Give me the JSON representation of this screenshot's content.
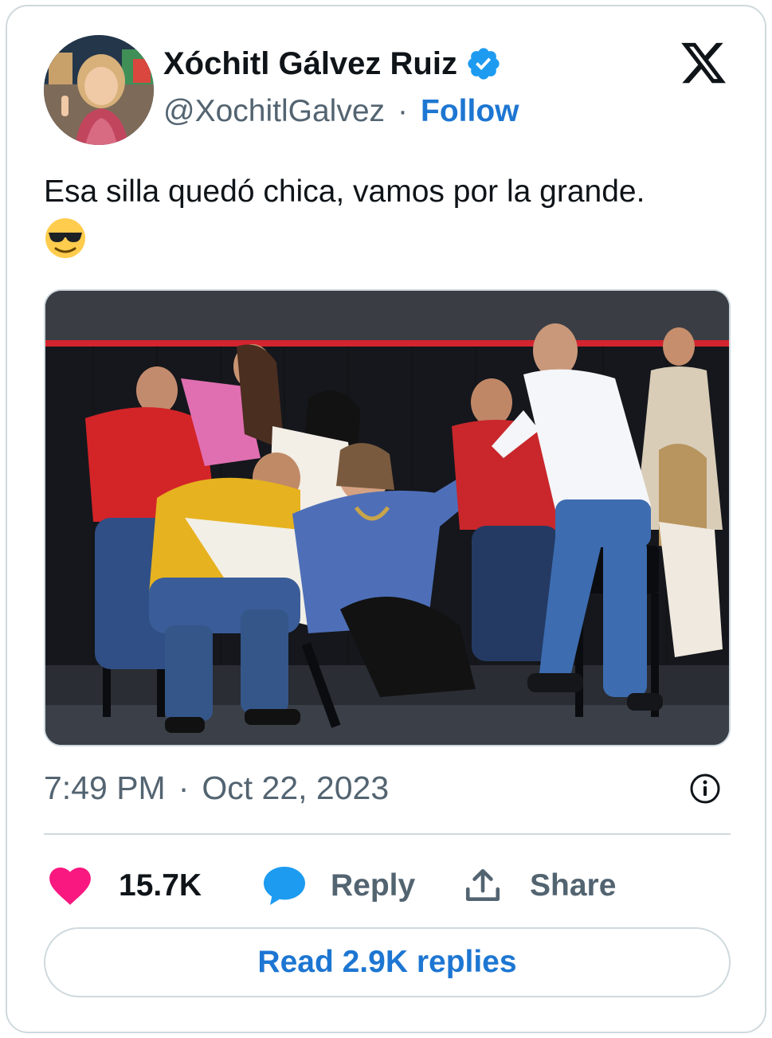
{
  "author": {
    "display_name": "Xóchitl Gálvez Ruiz",
    "handle": "@XochitlGalvez",
    "separator": "·",
    "follow_label": "Follow",
    "verified": true
  },
  "tweet": {
    "text": "Esa silla quedó chica, vamos por la grande.",
    "emoji": "smiling-face-with-sunglasses",
    "time": "7:49 PM",
    "separator": "·",
    "date": "Oct 22, 2023"
  },
  "actions": {
    "likes_count": "15.7K",
    "reply_label": "Reply",
    "share_label": "Share"
  },
  "read_replies_label": "Read 2.9K replies",
  "icons": {
    "brand": "x-logo-icon",
    "verified": "verified-badge-icon",
    "info": "info-icon",
    "like": "heart-icon",
    "reply": "speech-bubble-icon",
    "share": "share-upload-icon"
  },
  "colors": {
    "link_blue": "#1d76d2",
    "verified_blue": "#1d9bf0",
    "heart_pink": "#f91880",
    "muted_text": "#536471",
    "border": "#cfd9de"
  }
}
